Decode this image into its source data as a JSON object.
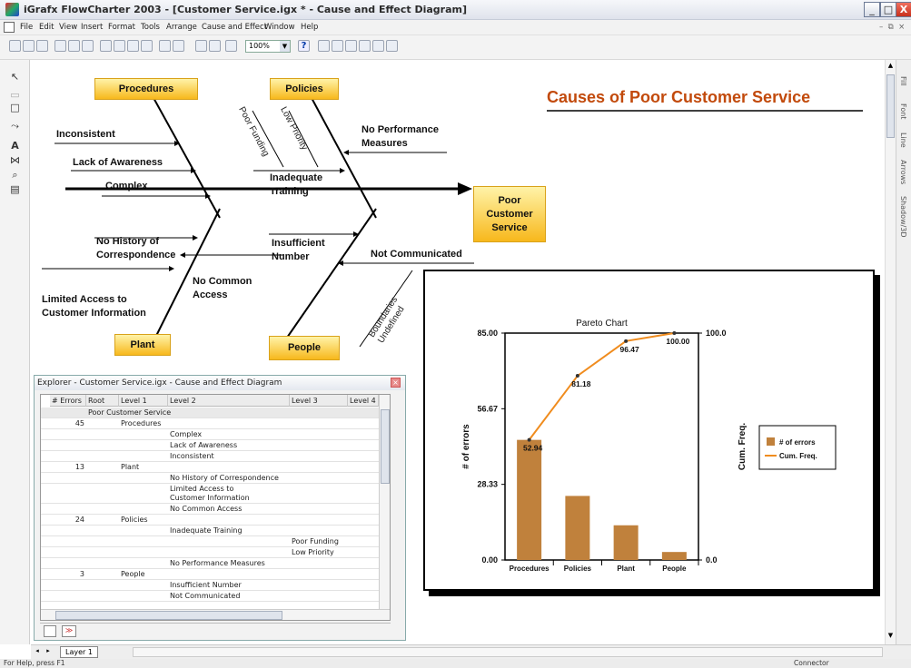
{
  "window": {
    "title": "iGrafx FlowCharter 2003 - [Customer Service.igx * - Cause and Effect Diagram]",
    "controls": [
      "_",
      "□",
      "X"
    ]
  },
  "menu": {
    "items": [
      "File",
      "Edit",
      "View",
      "Insert",
      "Format",
      "Tools",
      "Arrange",
      "Cause and Effect",
      "Window",
      "Help"
    ]
  },
  "toolbar": {
    "zoom": "100%"
  },
  "diagram": {
    "title": "Causes of Poor Customer Service",
    "effect": "Poor Customer Service",
    "categories": {
      "procedures": "Procedures",
      "policies": "Policies",
      "plant": "Plant",
      "people": "People"
    },
    "causes": {
      "inconsistent": "Inconsistent",
      "lack_awareness": "Lack of Awareness",
      "complex": "Complex",
      "no_perf": "No Performance Measures",
      "inadequate_training": "Inadequate Training",
      "poor_funding": "Poor Funding",
      "low_priority": "Low Priority",
      "no_history": "No History of Correspondence",
      "no_common": "No Common Access",
      "limited_access": "Limited Access to Customer Information",
      "insufficient": "Insufficient Number",
      "not_communicated": "Not Communicated",
      "boundaries": "Boundaries Undefined"
    }
  },
  "explorer": {
    "title": "Explorer - Customer Service.igx - Cause and Effect Diagram",
    "columns": [
      "# Errors",
      "Root",
      "Level 1",
      "Level 2",
      "Level 3",
      "Level 4",
      "L"
    ],
    "rows": [
      {
        "errors": "",
        "root": "Poor Customer Service",
        "l1": "",
        "l2": "",
        "l3": ""
      },
      {
        "errors": "45",
        "root": "",
        "l1": "Procedures",
        "l2": "",
        "l3": ""
      },
      {
        "errors": "",
        "root": "",
        "l1": "",
        "l2": "Complex",
        "l3": ""
      },
      {
        "errors": "",
        "root": "",
        "l1": "",
        "l2": "Lack of Awareness",
        "l3": ""
      },
      {
        "errors": "",
        "root": "",
        "l1": "",
        "l2": "Inconsistent",
        "l3": ""
      },
      {
        "errors": "13",
        "root": "",
        "l1": "Plant",
        "l2": "",
        "l3": ""
      },
      {
        "errors": "",
        "root": "",
        "l1": "",
        "l2": "No History of Correspondence",
        "l3": ""
      },
      {
        "errors": "",
        "root": "",
        "l1": "",
        "l2": "Limited Access to\nCustomer Information",
        "l3": ""
      },
      {
        "errors": "",
        "root": "",
        "l1": "",
        "l2": "No Common Access",
        "l3": ""
      },
      {
        "errors": "24",
        "root": "",
        "l1": "Policies",
        "l2": "",
        "l3": ""
      },
      {
        "errors": "",
        "root": "",
        "l1": "",
        "l2": "Inadequate Training",
        "l3": ""
      },
      {
        "errors": "",
        "root": "",
        "l1": "",
        "l2": "",
        "l3": "Poor Funding"
      },
      {
        "errors": "",
        "root": "",
        "l1": "",
        "l2": "",
        "l3": "Low Priority"
      },
      {
        "errors": "",
        "root": "",
        "l1": "",
        "l2": "No Performance Measures",
        "l3": ""
      },
      {
        "errors": "3",
        "root": "",
        "l1": "People",
        "l2": "",
        "l3": ""
      },
      {
        "errors": "",
        "root": "",
        "l1": "",
        "l2": "Insufficient Number",
        "l3": ""
      },
      {
        "errors": "",
        "root": "",
        "l1": "",
        "l2": "Not Communicated",
        "l3": ""
      }
    ]
  },
  "layer_tab": "Layer 1",
  "status": {
    "left": "For Help, press F1",
    "right": "Connector"
  },
  "right_tabs": [
    "Fill",
    "Font",
    "Line",
    "Arrows",
    "Shadow/3D"
  ],
  "chart_data": {
    "type": "bar",
    "title": "Pareto Chart",
    "categories": [
      "Procedures",
      "Policies",
      "Plant",
      "People"
    ],
    "series": [
      {
        "name": "# of errors",
        "values": [
          45,
          24,
          13,
          3
        ],
        "color": "#c0813c"
      },
      {
        "name": "Cum. Freq.",
        "values": [
          52.94,
          81.18,
          96.47,
          100.0
        ],
        "color": "#f08c1e",
        "type": "line"
      }
    ],
    "ylabel": "# of errors",
    "y2label": "Cum. Freq.",
    "ylim": [
      0,
      85
    ],
    "y2lim": [
      0,
      100
    ],
    "y_ticks": [
      "0.00",
      "28.33",
      "56.67",
      "85.00"
    ],
    "y2_ticks": [
      "0.0",
      "100.0"
    ],
    "point_labels": [
      "52.94",
      "81.18",
      "96.47",
      "100.00"
    ],
    "legend": "right"
  }
}
